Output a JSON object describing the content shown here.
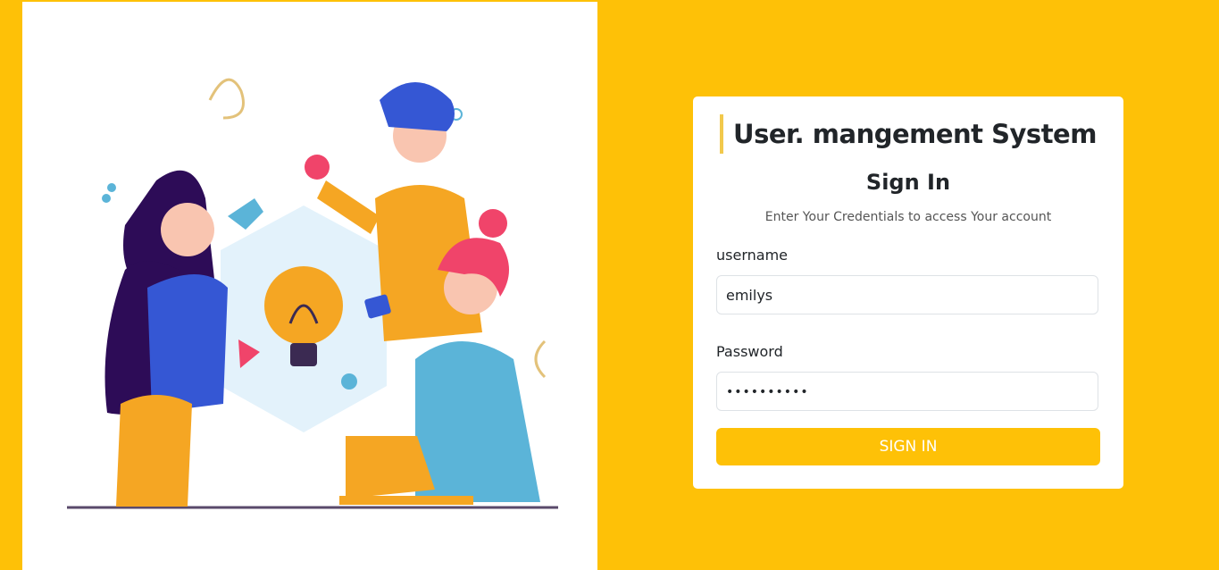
{
  "app_title": "User. mangement System",
  "heading": "Sign In",
  "subtitle": "Enter Your Credentials to access Your account",
  "username": {
    "label": "username",
    "value": "emilys"
  },
  "password": {
    "label": "Password",
    "masked_value": "••••••••••"
  },
  "submit": {
    "label": "SIGN IN"
  },
  "colors": {
    "background": "#fec107",
    "accent": "#fec107",
    "title_border": "#f2c94c"
  },
  "illustration": {
    "icon": "team-brainstorm-illustration"
  }
}
